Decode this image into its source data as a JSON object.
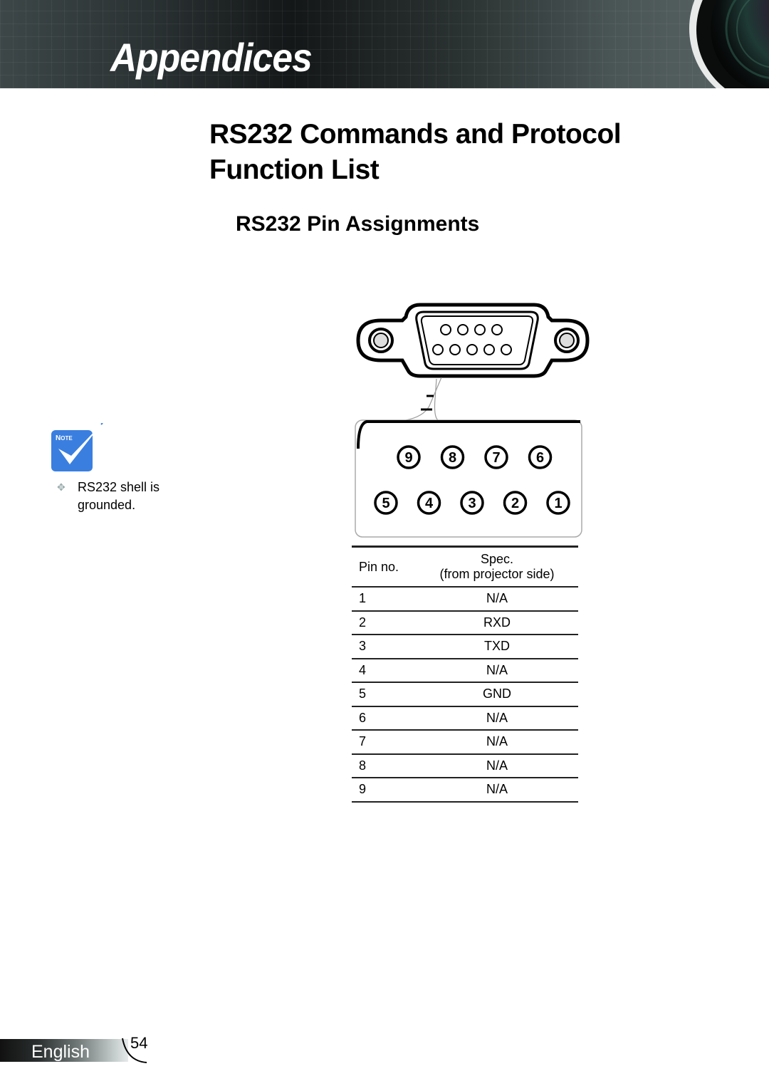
{
  "header": {
    "section_title": "Appendices"
  },
  "page": {
    "title": "RS232 Commands and Protocol Function List",
    "subtitle": "RS232 Pin Assignments"
  },
  "note": {
    "icon_label": "Note",
    "text": "RS232 shell is grounded."
  },
  "diagram": {
    "top_row_pins": [
      "9",
      "8",
      "7",
      "6"
    ],
    "bottom_row_pins": [
      "5",
      "4",
      "3",
      "2",
      "1"
    ]
  },
  "table": {
    "headers": {
      "pin": "Pin no.",
      "spec_line1": "Spec.",
      "spec_line2": "(from projector side)"
    },
    "rows": [
      {
        "pin": "1",
        "spec": "N/A"
      },
      {
        "pin": "2",
        "spec": "RXD"
      },
      {
        "pin": "3",
        "spec": "TXD"
      },
      {
        "pin": "4",
        "spec": "N/A"
      },
      {
        "pin": "5",
        "spec": "GND"
      },
      {
        "pin": "6",
        "spec": "N/A"
      },
      {
        "pin": "7",
        "spec": "N/A"
      },
      {
        "pin": "8",
        "spec": "N/A"
      },
      {
        "pin": "9",
        "spec": "N/A"
      }
    ]
  },
  "footer": {
    "language": "English",
    "page_number": "54"
  },
  "colors": {
    "note_blue": "#3a7fe0",
    "text": "#000000"
  }
}
